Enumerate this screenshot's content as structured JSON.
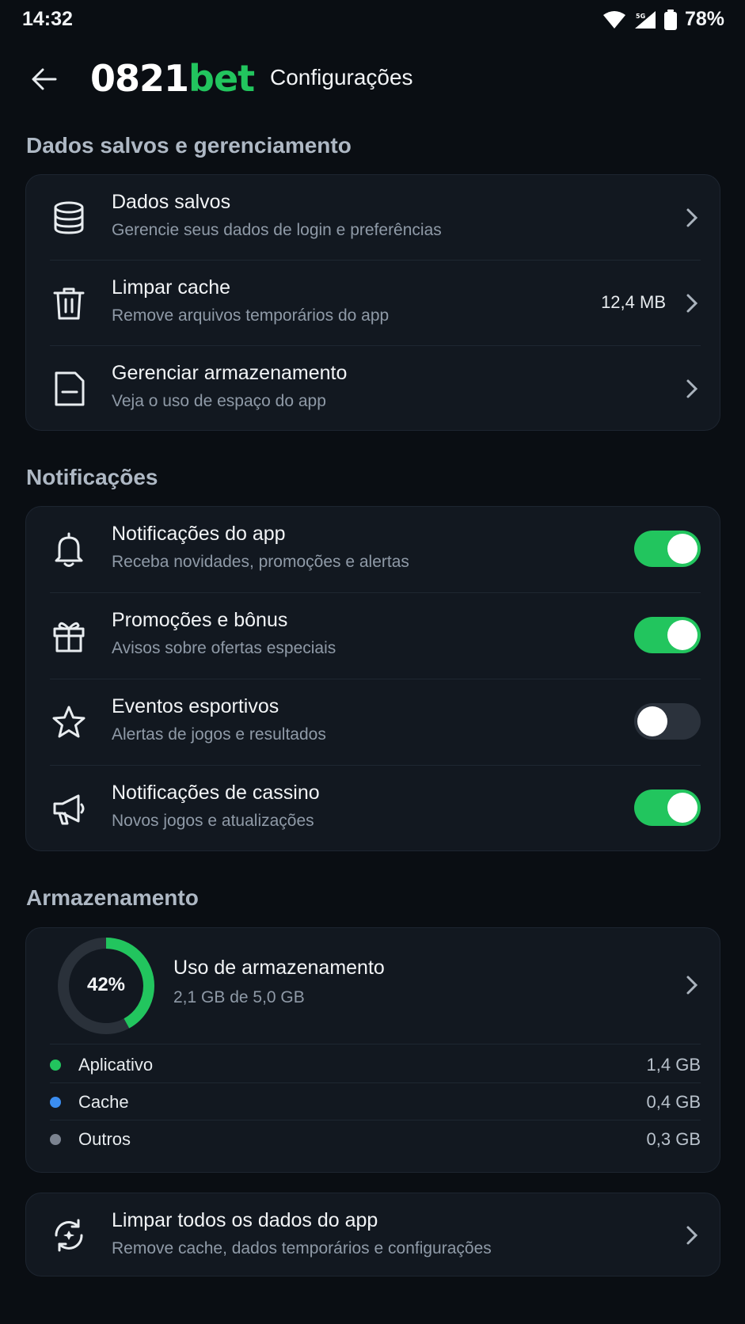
{
  "status_bar": {
    "time": "14:32",
    "battery": "78%"
  },
  "header": {
    "logo_number": "0821",
    "logo_suffix": "bet",
    "title": "Configurações"
  },
  "sections": {
    "data": "Dados salvos e gerenciamento",
    "notifications": "Notificações",
    "storage": "Armazenamento"
  },
  "data_items": [
    {
      "label": "Dados salvos",
      "sub": "Gerencie seus dados de login e preferências",
      "icon": "database-icon"
    },
    {
      "label": "Limpar cache",
      "sub": "Remove arquivos temporários do app",
      "value": "12,4 MB",
      "icon": "trash-icon"
    },
    {
      "label": "Gerenciar armazenamento",
      "sub": "Veja o uso de espaço do app",
      "icon": "sd-card-icon"
    }
  ],
  "notification_items": [
    {
      "label": "Notificações do app",
      "sub": "Receba novidades, promoções e alertas",
      "enabled": true,
      "icon": "bell-icon"
    },
    {
      "label": "Promoções e bônus",
      "sub": "Avisos sobre ofertas especiais",
      "enabled": true,
      "icon": "gift-icon"
    },
    {
      "label": "Eventos esportivos",
      "sub": "Alertas de jogos e resultados",
      "enabled": false,
      "icon": "star-icon"
    },
    {
      "label": "Notificações de cassino",
      "sub": "Novos jogos e atualizações",
      "enabled": true,
      "icon": "megaphone-icon"
    }
  ],
  "storage": {
    "percent_label": "42%",
    "percent": 0.42,
    "title": "Uso de armazenamento",
    "sub": "2,1 GB de 5,0 GB",
    "breakdown": [
      {
        "name": "Aplicativo",
        "value": "1,4 GB",
        "color": "#22c55e"
      },
      {
        "name": "Cache",
        "value": "0,4 GB",
        "color": "#3b8df0"
      },
      {
        "name": "Outros",
        "value": "0,3 GB",
        "color": "#7b8390"
      }
    ]
  },
  "clear_all": {
    "label": "Limpar todos os dados do app",
    "sub": "Remove cache, dados temporários e configurações",
    "icon": "reset-icon"
  },
  "colors": {
    "accent": "#22c55e",
    "background": "#0a0e13",
    "card": "#121820"
  }
}
